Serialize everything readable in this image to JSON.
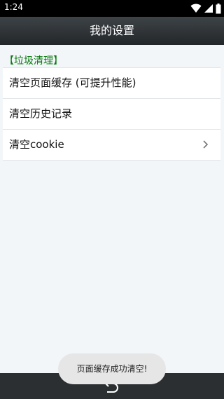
{
  "status_bar": {
    "time": "1:24"
  },
  "header": {
    "title": "我的设置"
  },
  "section": {
    "title": "【垃圾清理】"
  },
  "settings": {
    "items": [
      {
        "label": "清空页面缓存 (可提升性能)"
      },
      {
        "label": "清空历史记录"
      },
      {
        "label": "清空cookie"
      }
    ]
  },
  "toast": {
    "message": "页面缓存成功清空!"
  },
  "icons": {
    "status": [
      "wifi-icon",
      "signal-icon",
      "battery-icon"
    ],
    "chevron": "chevron-right-icon",
    "nav": "back-icon"
  },
  "colors": {
    "section_title": "#0a7a10",
    "header_bg": "#2f3336",
    "page_bg": "#f2f6f9"
  }
}
